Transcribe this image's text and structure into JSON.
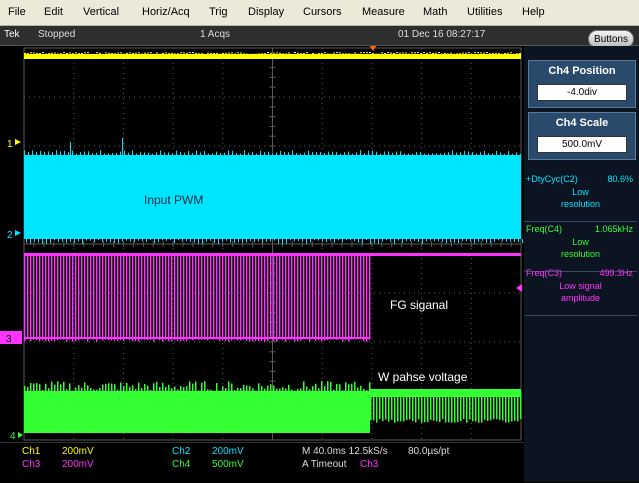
{
  "menu": [
    "File",
    "Edit",
    "Vertical",
    "Horiz/Acq",
    "Trig",
    "Display",
    "Cursors",
    "Measure",
    "Math",
    "Utilities",
    "Help"
  ],
  "status": {
    "brand": "Tek",
    "state": "Stopped",
    "acqs": "1 Acqs",
    "datetime": "01 Dec 16 08:27:17"
  },
  "buttons_label": "Buttons",
  "ch4_position": {
    "title": "Ch4 Position",
    "value": "-4.0div"
  },
  "ch4_scale": {
    "title": "Ch4 Scale",
    "value": "500.0mV"
  },
  "measurements": [
    {
      "label": "+DtyCyc(C2)",
      "value": "80.6%",
      "note": "Low\nresolution",
      "color": "#00e5ff"
    },
    {
      "label": "Freq(C4)",
      "value": "1.065kHz",
      "note": "Low\nresolution",
      "color": "#33ff33"
    },
    {
      "label": "Freq(C3)",
      "value": "499.3Hz",
      "note": "Low signal\namplitude",
      "color": "#ff33ff"
    }
  ],
  "channel_markers": [
    "1",
    "2",
    "3",
    "4"
  ],
  "annotations": {
    "input_pwm": "Input PWM",
    "fg_signal": "FG siganal",
    "w_phase": "W pahse voltage"
  },
  "bottom": {
    "ch1_label": "Ch1",
    "ch1_scale": "200mV",
    "ch2_label": "Ch2",
    "ch2_scale": "200mV",
    "ch3_label": "Ch3",
    "ch3_scale": "200mV",
    "ch4_label": "Ch4",
    "ch4_scale": "500mV",
    "timebase": "M 40.0ms 12.5kS/s",
    "sample": "80.0µs/pt",
    "trigger": "A  Timeout",
    "trigger_src": "Ch3"
  },
  "colors": {
    "ch1": "#ffff00",
    "ch2": "#00e5ff",
    "ch3": "#ff33ff",
    "ch4": "#33ff33",
    "grid": "#5a5a5a"
  }
}
